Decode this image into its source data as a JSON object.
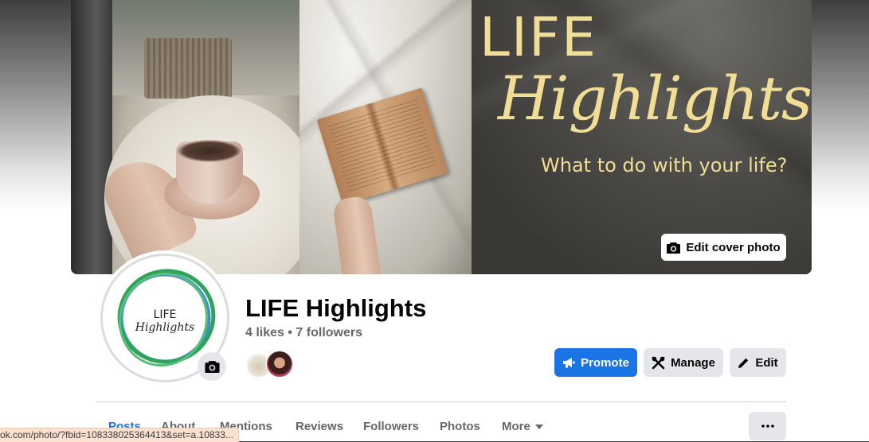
{
  "cover": {
    "line1": "LIFE",
    "line2": "Highlights",
    "line3": "What to do with your life?",
    "edit_cover_label": "Edit cover photo"
  },
  "profile": {
    "logo_line1": "LIFE",
    "logo_line2": "Highlights",
    "name": "LIFE Highlights",
    "stats": "4 likes • 7 followers"
  },
  "actions": {
    "promote_label": "Promote",
    "manage_label": "Manage",
    "edit_label": "Edit"
  },
  "tabs": [
    {
      "label": "Posts",
      "active": true
    },
    {
      "label": "About",
      "active": false
    },
    {
      "label": "Mentions",
      "active": false
    },
    {
      "label": "Reviews",
      "active": false
    },
    {
      "label": "Followers",
      "active": false
    },
    {
      "label": "Photos",
      "active": false
    },
    {
      "label": "More",
      "active": false
    }
  ],
  "more_menu_label": "...",
  "status_url": "ok.com/photo/?fbid=108338025364413&set=a.10833...",
  "colors": {
    "accent": "#1b74e4",
    "cover_text": "#f2dd95",
    "logo_green": "#2fa35a",
    "logo_blue": "#3d8fd1"
  },
  "icons": [
    "camera-icon",
    "megaphone-icon",
    "tools-icon",
    "pencil-icon",
    "chevron-down-icon",
    "ellipsis-icon"
  ]
}
